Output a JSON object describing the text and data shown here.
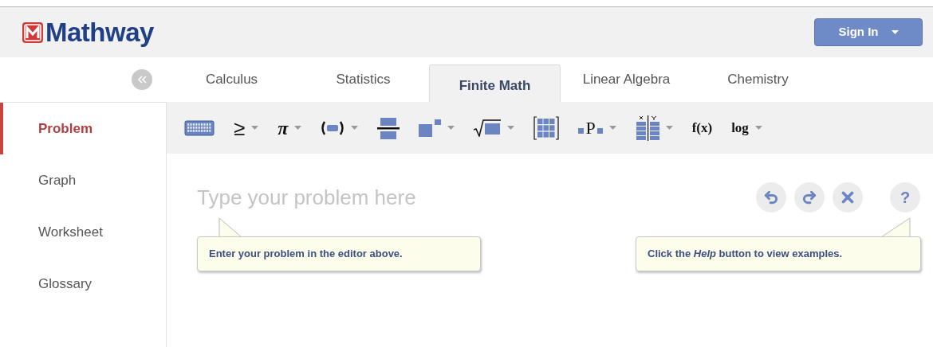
{
  "header": {
    "logo": "Mathway",
    "sign_in": {
      "label": "Sign In",
      "caret": true
    }
  },
  "tabs": [
    {
      "label": "Calculus",
      "selected": false
    },
    {
      "label": "Statistics",
      "selected": false
    },
    {
      "label": "Finite Math",
      "selected": true
    },
    {
      "label": "Linear Algebra",
      "selected": false
    },
    {
      "label": "Chemistry",
      "selected": false
    }
  ],
  "sidebar": {
    "items": [
      {
        "label": "Problem",
        "selected": true
      },
      {
        "label": "Graph",
        "selected": false
      },
      {
        "label": "Worksheet",
        "selected": false
      },
      {
        "label": "Glossary",
        "selected": false
      }
    ]
  },
  "toolbar": [
    {
      "kind": "keyboard",
      "caret": false
    },
    {
      "kind": "text",
      "label": "≥",
      "caret": true
    },
    {
      "kind": "italic",
      "label": "π",
      "caret": true
    },
    {
      "kind": "paren",
      "caret": true
    },
    {
      "kind": "fraction",
      "caret": false
    },
    {
      "kind": "power",
      "caret": true
    },
    {
      "kind": "sqrt",
      "caret": true
    },
    {
      "kind": "matrix",
      "caret": false
    },
    {
      "kind": "perm",
      "label": "P",
      "caret": true
    },
    {
      "kind": "table",
      "caret": true
    },
    {
      "kind": "serif",
      "label": "f(x)",
      "caret": false
    },
    {
      "kind": "serif",
      "label": "log",
      "caret": true
    }
  ],
  "editor": {
    "placeholder": "Type your problem here",
    "actions": [
      {
        "kind": "undo"
      },
      {
        "kind": "redo"
      },
      {
        "kind": "clear"
      },
      {
        "kind": "help",
        "label": "?"
      }
    ]
  },
  "tooltips": [
    {
      "text": "Enter your problem in the editor above.",
      "kind": "left"
    },
    {
      "text": "Click the *Help* button to view examples.",
      "kind": "right"
    }
  ]
}
